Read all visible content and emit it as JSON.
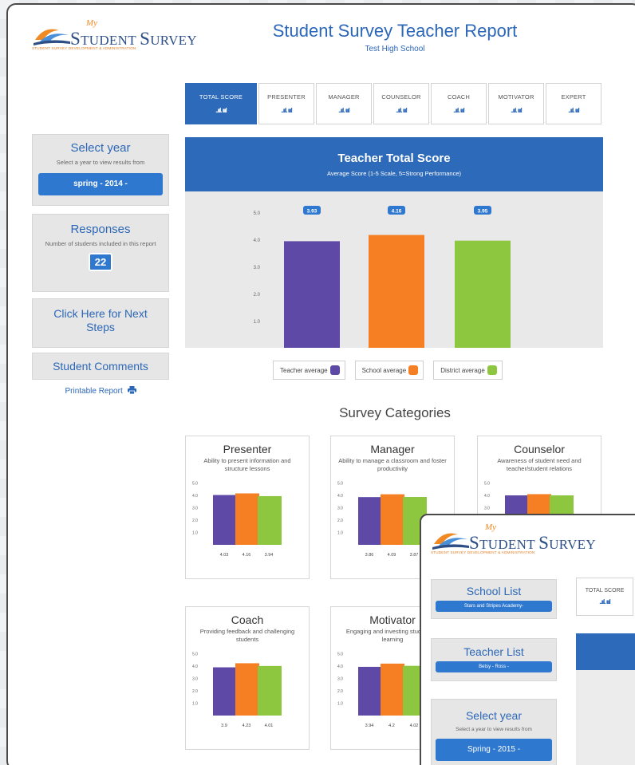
{
  "header": {
    "logo_my": "My",
    "logo_first_letter": "S",
    "logo_word1": "TUDENT ",
    "logo_first_letter2": "S",
    "logo_word2": "URVEY",
    "logo_tagline": "STUDENT SURVEY DEVELOPMENT & ADMINISTRATION",
    "title": "Student Survey Teacher Report",
    "subtitle": "Test High School"
  },
  "tabs": [
    {
      "label": "TOTAL SCORE",
      "icon": "bar-chart-icon",
      "active": true
    },
    {
      "label": "PRESENTER",
      "icon": "bar-chart-icon"
    },
    {
      "label": "MANAGER",
      "icon": "bar-chart-icon"
    },
    {
      "label": "COUNSELOR",
      "icon": "bar-chart-icon"
    },
    {
      "label": "COACH",
      "icon": "bar-chart-icon"
    },
    {
      "label": "MOTIVATOR",
      "icon": "bar-chart-icon"
    },
    {
      "label": "EXPERT",
      "icon": "bar-chart-icon"
    }
  ],
  "sidebar": {
    "year_title": "Select year",
    "year_desc": "Select a year to view results from",
    "year_value": "spring - 2014 -",
    "responses_title": "Responses",
    "responses_desc": "Number of students included in this report",
    "responses_count": "22",
    "next_steps": "Click Here for Next Steps",
    "comments": "Student Comments",
    "printable": "Printable Report",
    "printable_icon": "printer-icon"
  },
  "chart_data": [
    {
      "type": "bar",
      "title": "Teacher Total Score",
      "subtitle": "Average Score (1-5 Scale, 5=Strong Performance)",
      "categories": [
        "Teacher average",
        "School average",
        "District average"
      ],
      "values": [
        3.93,
        4.16,
        3.95
      ],
      "data_labels": [
        "3.93",
        "4.16",
        "3.95"
      ],
      "yticks": [
        "5.0",
        "4.0",
        "3.0",
        "2.0",
        "1.0"
      ],
      "ylim": [
        0,
        5
      ],
      "colors": [
        "#5e4aa6",
        "#f57f22",
        "#8dc63f"
      ]
    },
    {
      "type": "bar",
      "title": "Presenter",
      "values": [
        4.03,
        4.16,
        3.94
      ],
      "labels": [
        "4.03",
        "4.16",
        "3.94"
      ],
      "ylim": [
        0,
        5
      ]
    },
    {
      "type": "bar",
      "title": "Manager",
      "values": [
        3.86,
        4.09,
        3.87
      ],
      "labels": [
        "3.86",
        "4.09",
        "3.87"
      ],
      "ylim": [
        0,
        5
      ]
    },
    {
      "type": "bar",
      "title": "Counselor",
      "values": [
        4.0,
        4.1,
        4.0
      ],
      "labels": [],
      "ylim": [
        0,
        5
      ]
    },
    {
      "type": "bar",
      "title": "Coach",
      "values": [
        3.9,
        4.23,
        4.01
      ],
      "labels": [
        "3.9",
        "4.23",
        "4.01"
      ],
      "ylim": [
        0,
        5
      ]
    },
    {
      "type": "bar",
      "title": "Motivator",
      "values": [
        3.94,
        4.2,
        4.02
      ],
      "labels": [
        "3.94",
        "4.2",
        "4.02"
      ],
      "ylim": [
        0,
        5
      ]
    }
  ],
  "legend": {
    "teacher": "Teacher average",
    "school": "School average",
    "district": "District average"
  },
  "categories_section": {
    "title": "Survey Categories",
    "cards": [
      {
        "title": "Presenter",
        "desc": "Ability to present information and structure lessons"
      },
      {
        "title": "Manager",
        "desc": "Ability to manage a classroom and foster productivity"
      },
      {
        "title": "Counselor",
        "desc": "Awareness of student need and teacher/student relations"
      },
      {
        "title": "Coach",
        "desc": "Providing feedback and challenging students"
      },
      {
        "title": "Motivator",
        "desc": "Engaging and investing students in learning"
      }
    ],
    "card_yticks": [
      "5.0",
      "4.0",
      "3.0",
      "2.0",
      "1.0"
    ]
  },
  "overlay": {
    "school_list_title": "School List",
    "school_list_value": "Stars and Stripes Academy-",
    "teacher_list_title": "Teacher List",
    "teacher_list_value": "Betsy - Ross -",
    "year_title": "Select year",
    "year_desc": "Select a year to view results from",
    "year_value": "Spring - 2015 -",
    "tab_label": "TOTAL SCORE"
  },
  "colors": {
    "primary_blue": "#2d6ab9",
    "teacher": "#5e4aa6",
    "school": "#f57f22",
    "district": "#8dc63f"
  }
}
